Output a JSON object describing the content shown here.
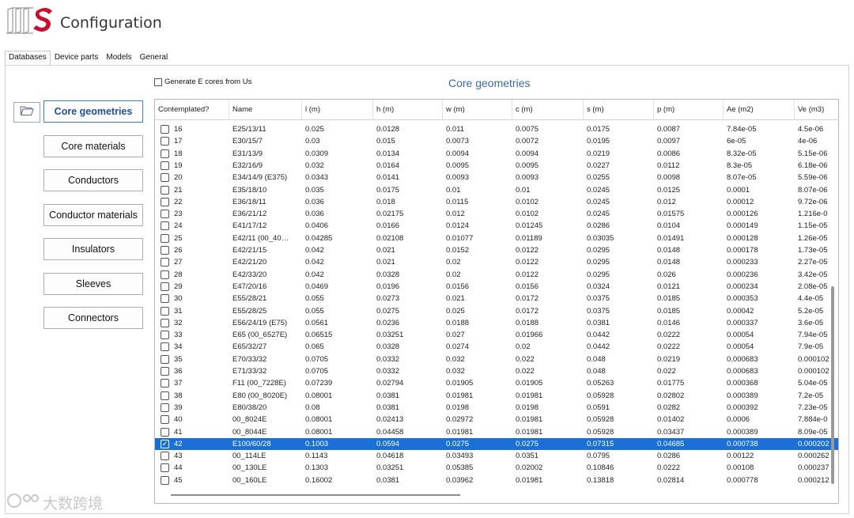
{
  "app": {
    "title": "Configuration"
  },
  "tabs": [
    {
      "label": "Databases",
      "active": true
    },
    {
      "label": "Device parts",
      "active": false
    },
    {
      "label": "Models",
      "active": false
    },
    {
      "label": "General",
      "active": false
    }
  ],
  "sidebar": {
    "folder_icon": "folder-open-icon",
    "items": [
      {
        "label": "Core geometries",
        "active": true
      },
      {
        "label": "Core materials",
        "active": false
      },
      {
        "label": "Conductors",
        "active": false
      },
      {
        "label": "Conductor materials",
        "active": false
      },
      {
        "label": "Insulators",
        "active": false
      },
      {
        "label": "Sleeves",
        "active": false
      },
      {
        "label": "Connectors",
        "active": false
      }
    ]
  },
  "generate_checkbox": {
    "label": "Generate E cores from Us",
    "checked": false
  },
  "section_title": "Core geometries",
  "table": {
    "columns": [
      "Contemplated?",
      "Name",
      "l (m)",
      "h (m)",
      "w (m)",
      "c (m)",
      "s (m)",
      "p (m)",
      "Ae (m2)",
      "Ve (m3)"
    ],
    "selected_index": 26,
    "rows": [
      [
        "16",
        "E25/13/11",
        "0.025",
        "0.0128",
        "0.011",
        "0.0075",
        "0.0175",
        "0.0087",
        "7.84e-05",
        "4.5e-06"
      ],
      [
        "17",
        "E30/15/7",
        "0.03",
        "0.015",
        "0.0073",
        "0.0072",
        "0.0195",
        "0.0097",
        "6e-05",
        "4e-06"
      ],
      [
        "18",
        "E31/13/9",
        "0.0309",
        "0.0134",
        "0.0094",
        "0.0094",
        "0.0219",
        "0.0086",
        "8.32e-05",
        "5.15e-06"
      ],
      [
        "19",
        "E32/16/9",
        "0.032",
        "0.0164",
        "0.0095",
        "0.0095",
        "0.0227",
        "0.0112",
        "8.3e-05",
        "6.18e-06"
      ],
      [
        "20",
        "E34/14/9 (E375)",
        "0.0343",
        "0.0141",
        "0.0093",
        "0.0093",
        "0.0255",
        "0.0098",
        "8.07e-05",
        "5.59e-06"
      ],
      [
        "21",
        "E35/18/10",
        "0.035",
        "0.0175",
        "0.01",
        "0.01",
        "0.0245",
        "0.0125",
        "0.0001",
        "8.07e-06"
      ],
      [
        "22",
        "E36/18/11",
        "0.036",
        "0.018",
        "0.0115",
        "0.0102",
        "0.0245",
        "0.012",
        "0.00012",
        "9.72e-06"
      ],
      [
        "23",
        "E36/21/12",
        "0.036",
        "0.02175",
        "0.012",
        "0.0102",
        "0.0245",
        "0.01575",
        "0.000126",
        "1.216e-0"
      ],
      [
        "24",
        "E41/17/12",
        "0.0406",
        "0.0166",
        "0.0124",
        "0.01245",
        "0.0286",
        "0.0104",
        "0.000149",
        "1.15e-05"
      ],
      [
        "25",
        "E42/11 (00_40…",
        "0.04285",
        "0.02108",
        "0.01077",
        "0.01189",
        "0.03035",
        "0.01491",
        "0.000128",
        "1.26e-05"
      ],
      [
        "26",
        "E42/21/15",
        "0.042",
        "0.021",
        "0.0152",
        "0.0122",
        "0.0295",
        "0.0148",
        "0.000178",
        "1.73e-05"
      ],
      [
        "27",
        "E42/21/20",
        "0.042",
        "0.021",
        "0.02",
        "0.0122",
        "0.0295",
        "0.0148",
        "0.000233",
        "2.27e-05"
      ],
      [
        "28",
        "E42/33/20",
        "0.042",
        "0.0328",
        "0.02",
        "0.0122",
        "0.0295",
        "0.026",
        "0.000236",
        "3.42e-05"
      ],
      [
        "29",
        "E47/20/16",
        "0.0469",
        "0.0196",
        "0.0156",
        "0.0156",
        "0.0324",
        "0.0121",
        "0.000234",
        "2.08e-05"
      ],
      [
        "30",
        "E55/28/21",
        "0.055",
        "0.0273",
        "0.021",
        "0.0172",
        "0.0375",
        "0.0185",
        "0.000353",
        "4.4e-05"
      ],
      [
        "31",
        "E55/28/25",
        "0.055",
        "0.0275",
        "0.025",
        "0.0172",
        "0.0375",
        "0.0185",
        "0.00042",
        "5.2e-05"
      ],
      [
        "32",
        "E56/24/19 (E75)",
        "0.0561",
        "0.0236",
        "0.0188",
        "0.0188",
        "0.0381",
        "0.0146",
        "0.000337",
        "3.6e-05"
      ],
      [
        "33",
        "E65 (00_6527E)",
        "0.06515",
        "0.03251",
        "0.027",
        "0.01966",
        "0.0442",
        "0.0222",
        "0.00054",
        "7.94e-05"
      ],
      [
        "34",
        "E65/32/27",
        "0.065",
        "0.0328",
        "0.0274",
        "0.02",
        "0.0442",
        "0.0222",
        "0.00054",
        "7.9e-05"
      ],
      [
        "35",
        "E70/33/32",
        "0.0705",
        "0.0332",
        "0.032",
        "0.022",
        "0.048",
        "0.0219",
        "0.000683",
        "0.000102"
      ],
      [
        "36",
        "E71/33/32",
        "0.0705",
        "0.0332",
        "0.032",
        "0.022",
        "0.048",
        "0.022",
        "0.000683",
        "0.000102"
      ],
      [
        "37",
        "F11 (00_7228E)",
        "0.07239",
        "0.02794",
        "0.01905",
        "0.01905",
        "0.05263",
        "0.01775",
        "0.000368",
        "5.04e-05"
      ],
      [
        "38",
        "E80 (00_8020E)",
        "0.08001",
        "0.0381",
        "0.01981",
        "0.01981",
        "0.05928",
        "0.02802",
        "0.000389",
        "7.2e-05"
      ],
      [
        "39",
        "E80/38/20",
        "0.08",
        "0.0381",
        "0.0198",
        "0.0198",
        "0.0591",
        "0.0282",
        "0.000392",
        "7.23e-05"
      ],
      [
        "40",
        "00_8024E",
        "0.08001",
        "0.02413",
        "0.02972",
        "0.01981",
        "0.05928",
        "0.01402",
        "0.0006",
        "7.884e-0"
      ],
      [
        "41",
        "00_8044E",
        "0.08001",
        "0.04458",
        "0.01981",
        "0.01981",
        "0.05928",
        "0.03437",
        "0.000389",
        "8.09e-05"
      ],
      [
        "42",
        "E100/60/28",
        "0.1003",
        "0.0594",
        "0.0275",
        "0.0275",
        "0.07315",
        "0.04685",
        "0.000738",
        "0.000202"
      ],
      [
        "43",
        "00_114LE",
        "0.1143",
        "0.04618",
        "0.03493",
        "0.0351",
        "0.0795",
        "0.0286",
        "0.00122",
        "0.000262"
      ],
      [
        "44",
        "00_130LE",
        "0.1303",
        "0.03251",
        "0.05385",
        "0.02002",
        "0.10846",
        "0.0222",
        "0.00108",
        "0.000237"
      ],
      [
        "45",
        "00_160LE",
        "0.16002",
        "0.0381",
        "0.03962",
        "0.01981",
        "0.13818",
        "0.02814",
        "0.000778",
        "0.000212"
      ]
    ]
  },
  "watermark": "大数跨境"
}
